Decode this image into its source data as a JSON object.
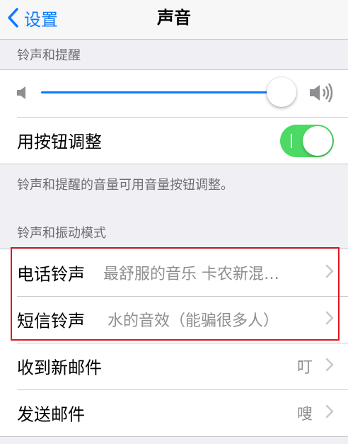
{
  "nav": {
    "back_label": "设置",
    "title": "声音"
  },
  "ringer_section": {
    "header": "铃声和提醒",
    "volume_slider": {
      "value": 1.0
    },
    "toggle_row": {
      "label": "用按钮调整",
      "enabled": true
    },
    "footer": "铃声和提醒的音量可用音量按钮调整。"
  },
  "vibration_section": {
    "header": "铃声和振动模式",
    "rows": [
      {
        "label": "电话铃声",
        "value": "最舒服的音乐 卡农新混…"
      },
      {
        "label": "短信铃声",
        "value": "水的音效（能骗很多人）"
      },
      {
        "label": "收到新邮件",
        "value": "叮"
      },
      {
        "label": "发送邮件",
        "value": "嗖"
      }
    ]
  },
  "colors": {
    "accent": "#0a7aff",
    "toggle_on": "#4cd964",
    "highlight": "#e3141e",
    "background": "#efeff4"
  },
  "icons": [
    "back-chevron-icon",
    "speaker-low-icon",
    "speaker-high-icon",
    "chevron-right-icon"
  ]
}
